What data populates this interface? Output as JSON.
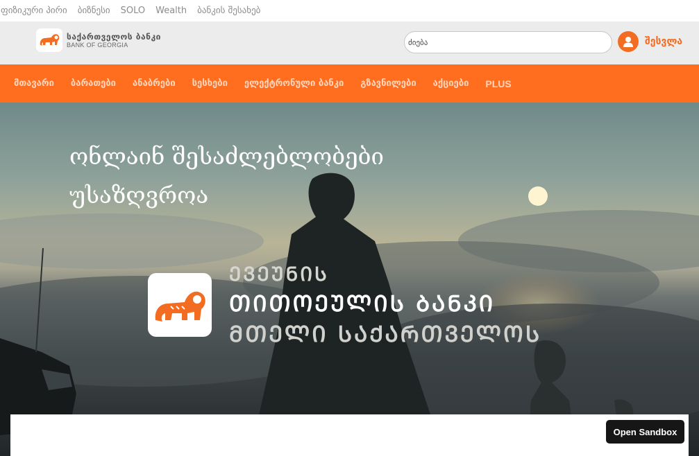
{
  "segments": [
    "ფიზიკური პირი",
    "ბიზნესი",
    "SOLO",
    "Wealth",
    "ბანკის შესახებ"
  ],
  "header": {
    "logo_name_ka": "საქართველოს ბანკი",
    "logo_name_en": "BANK OF GEORGIA",
    "search_placeholder": "ძიება",
    "login_label": "შესვლა"
  },
  "nav": [
    "მთავარი",
    "ბარათები",
    "ანაბრები",
    "სესხები",
    "ელექტრონული ბანკი",
    "გზავნილები",
    "აქციები",
    "PLUS"
  ],
  "hero": {
    "title_line1": "ონლაინ შესაძლებლობები",
    "title_line2": "უსაზღვროა",
    "campaign_line1": "ᲔᲕᲔᲣᲜᲘᲡ",
    "campaign_line2": "ᲗᲘᲗᲝᲔᲣᲚᲘᲡ ᲑᲐᲜᲙᲘ",
    "campaign_line3": "ᲛᲗᲔᲚᲘ ᲡᲐᲥᲐᲠᲗᲕᲔᲚᲝᲡ"
  },
  "sandbox_button": "Open Sandbox",
  "colors": {
    "brand_orange": "#ff6d1f",
    "header_bg": "#ececec",
    "button_dark": "#161616"
  }
}
